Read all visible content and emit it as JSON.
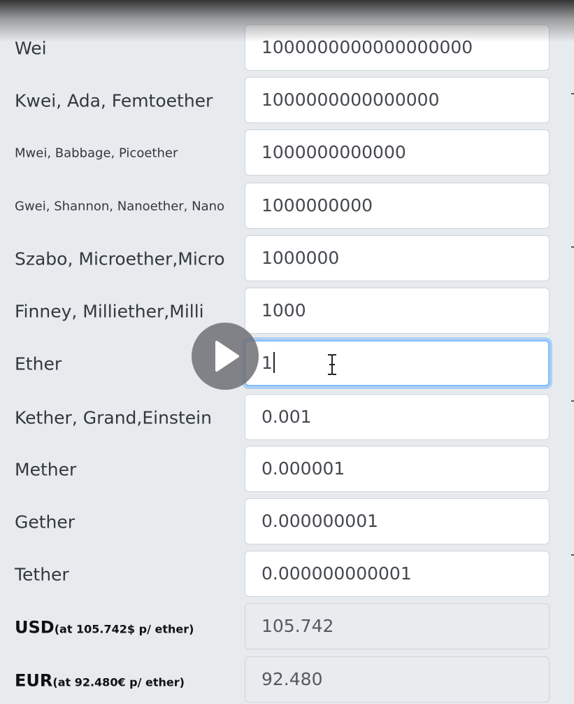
{
  "units": [
    {
      "label": "Wei",
      "value": "1000000000000000000"
    },
    {
      "label": "Kwei, Ada, Femtoether",
      "value": "1000000000000000"
    },
    {
      "label": "Mwei, Babbage, Picoether",
      "value": "1000000000000"
    },
    {
      "label": "Gwei, Shannon, Nanoether, Nano",
      "value": "1000000000"
    },
    {
      "label": "Szabo, Microether,Micro",
      "value": "1000000"
    },
    {
      "label": "Finney, Milliether,Milli",
      "value": "1000"
    },
    {
      "label": "Ether",
      "value": "1"
    },
    {
      "label": "Kether, Grand,Einstein",
      "value": "0.001"
    },
    {
      "label": "Mether",
      "value": "0.000001"
    },
    {
      "label": "Gether",
      "value": "0.000000001"
    },
    {
      "label": "Tether",
      "value": "0.000000000001"
    }
  ],
  "fiat": [
    {
      "currency": "USD",
      "rate_note": "(at 105.742$ p/ ether)",
      "value": "105.742"
    },
    {
      "currency": "EUR",
      "rate_note": "(at 92.480€ p/ ether)",
      "value": "92.480"
    }
  ],
  "overlay": {
    "play_icon": "play-icon",
    "cursor_icon": "text-cursor-icon"
  },
  "colors": {
    "page_background": "#e8ebee",
    "focus_ring": "#80bdff",
    "readonly_background": "#e9ecef"
  }
}
